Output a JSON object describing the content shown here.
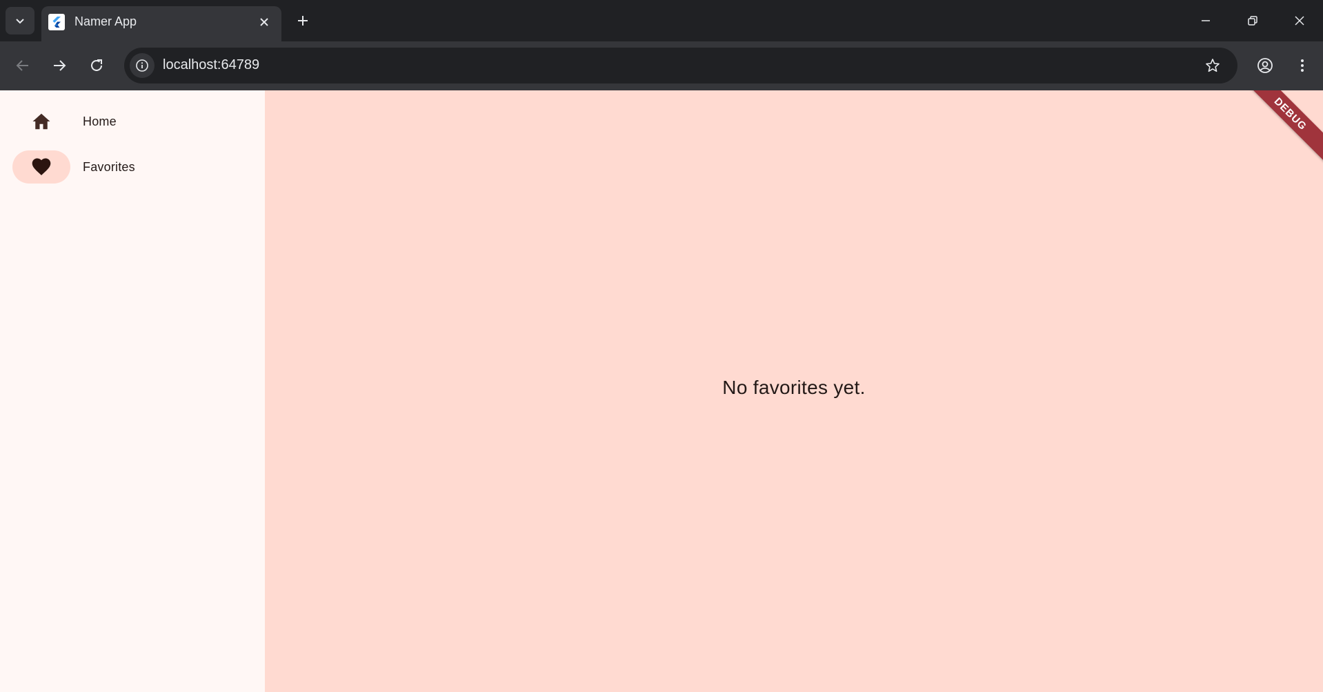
{
  "browser": {
    "tab": {
      "title": "Namer App",
      "favicon": "flutter-icon"
    },
    "url": "localhost:64789",
    "icons": {
      "tab_search": "chevron-down-icon",
      "tab_close": "close-icon",
      "new_tab": "plus-icon",
      "back": "arrow-left-icon",
      "forward": "arrow-right-icon",
      "reload": "reload-icon",
      "site_info": "info-icon",
      "bookmark": "star-icon",
      "profile": "profile-icon",
      "menu": "kebab-menu-icon",
      "minimize": "minimize-icon",
      "restore": "restore-icon",
      "close_window": "close-icon"
    }
  },
  "app": {
    "navigation_rail": {
      "items": [
        {
          "label": "Home",
          "icon": "home-icon",
          "selected": false
        },
        {
          "label": "Favorites",
          "icon": "heart-icon",
          "selected": true
        }
      ]
    },
    "main": {
      "empty_message": "No favorites yet."
    },
    "debug_banner": "DEBUG"
  },
  "colors": {
    "rail_background": "#fff7f5",
    "content_background": "#ffdad1",
    "selected_indicator": "#ffdad1",
    "text": "#231917",
    "debug_banner": "#a0343c"
  }
}
